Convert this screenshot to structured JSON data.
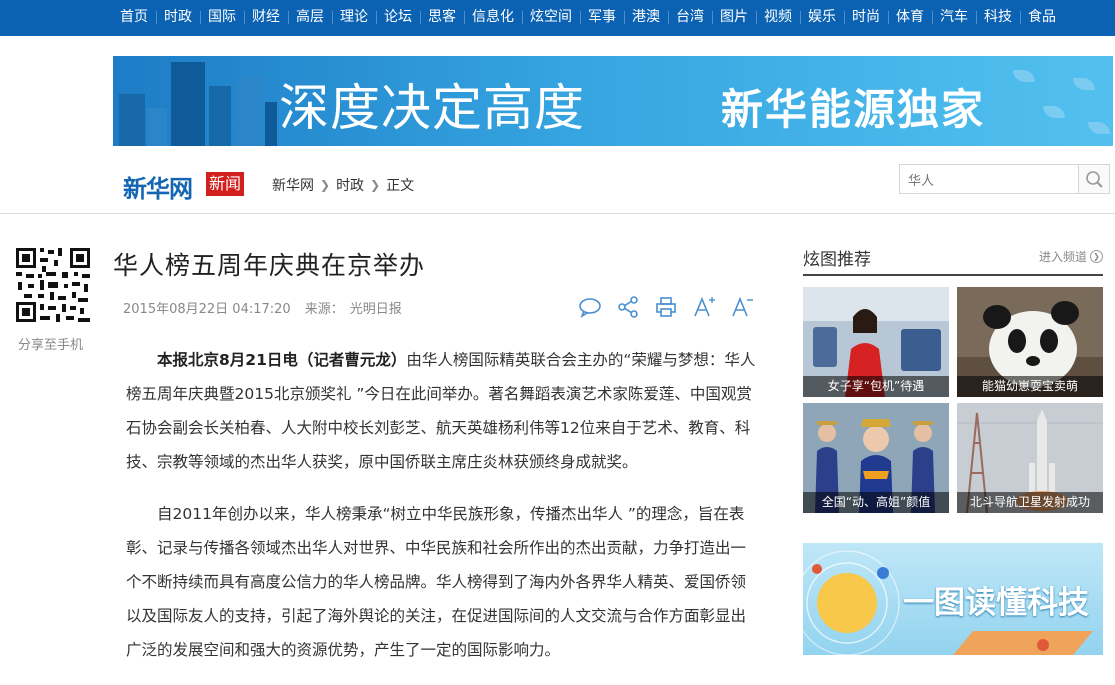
{
  "topnav": {
    "items": [
      "首页",
      "时政",
      "国际",
      "财经",
      "高层",
      "理论",
      "论坛",
      "思客",
      "信息化",
      "炫空间",
      "军事",
      "港澳",
      "台湾",
      "图片",
      "视频",
      "娱乐",
      "时尚",
      "体育",
      "汽车",
      "科技",
      "食品"
    ]
  },
  "banner": {
    "slogan": "深度决定高度",
    "brand": "新华能源独家"
  },
  "header": {
    "logo": "新华网",
    "logo_tag": "新闻",
    "breadcrumb": [
      "新华网",
      "时政",
      "正文"
    ],
    "search_value": "华人"
  },
  "share": {
    "label": "分享至手机"
  },
  "article": {
    "title": "华人榜五周年庆典在京举办",
    "date": "2015年08月22日 04:17:20",
    "source_label": "来源：",
    "source": "光明日报",
    "lead": "本报北京8月21日电（记者曹元龙）",
    "p1": "由华人榜国际精英联合会主办的“荣耀与梦想：华人榜五周年庆典暨2015北京颁奖礼 ”今日在此间举办。著名舞蹈表演艺术家陈爱莲、中国观赏石协会副会长关柏春、人大附中校长刘彭芝、航天英雄杨利伟等12位来自于艺术、教育、科技、宗教等领域的杰出华人获奖，原中国侨联主席庄炎林获颁终身成就奖。",
    "p2": "自2011年创办以来，华人榜秉承“树立中华民族形象，传播杰出华人 ”的理念，旨在表彰、记录与传播各领域杰出华人对世界、中华民族和社会所作出的杰出贡献，力争打造出一个不断持续而具有高度公信力的华人榜品牌。华人榜得到了海内外各界华人精英、爱国侨领以及国际友人的支持，引起了海外舆论的关注，在促进国际间的人文交流与合作方面彰显出广泛的发展空间和强大的资源优势，产生了一定的国际影响力。"
  },
  "tools": {
    "icons": [
      "comment-icon",
      "share-icon",
      "print-icon",
      "font-increase-icon",
      "font-decrease-icon"
    ]
  },
  "sidebar": {
    "title": "炫图推荐",
    "more": "进入频道",
    "photos": [
      {
        "caption": "女子享“包机”待遇"
      },
      {
        "caption": "能猫幼崽耍宝卖萌"
      },
      {
        "caption": "全国“动、高姐”颜值"
      },
      {
        "caption": "北斗导航卫星发射成功"
      }
    ],
    "promo": "一图读懂科技"
  },
  "colors": {
    "nav_blue": "#0b62b3",
    "logo_red": "#d2201d",
    "icon_blue": "#4a8fd0"
  }
}
